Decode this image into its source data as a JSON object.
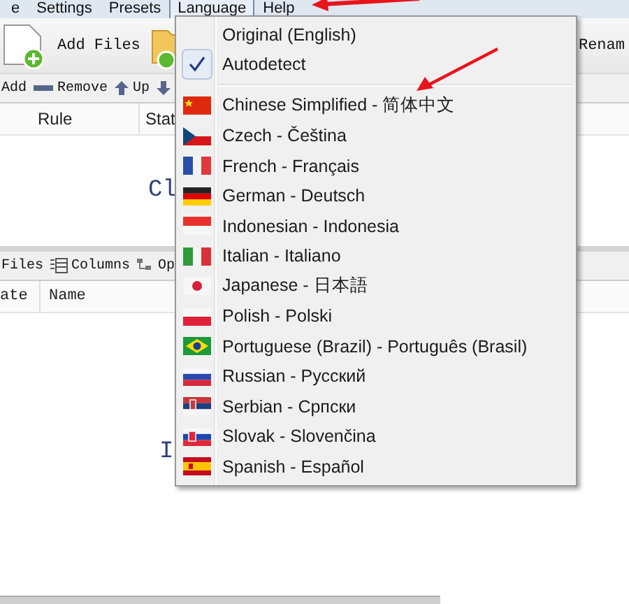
{
  "menu_bar": [
    {
      "label": "e",
      "selected": false
    },
    {
      "label": "Settings",
      "selected": false
    },
    {
      "label": "Presets",
      "selected": false
    },
    {
      "label": "Language",
      "selected": true
    },
    {
      "label": "Help",
      "selected": false
    }
  ],
  "toolbar": {
    "add_files": "Add Files",
    "rename": "Renam"
  },
  "rules_toolbar": [
    "Add",
    "Remove",
    "Up"
  ],
  "rules_columns": [
    "Rule",
    "Stat"
  ],
  "rules_hint": "Cl",
  "files_toolbar": [
    "Files",
    "Columns",
    "Op"
  ],
  "files_columns": [
    "ate",
    "Name"
  ],
  "files_hint": "I",
  "language_menu": [
    {
      "kind": "item",
      "label": "Original (English)",
      "checked": false
    },
    {
      "kind": "item",
      "label": "Autodetect",
      "checked": true
    },
    {
      "kind": "separator"
    },
    {
      "kind": "item",
      "label": "Chinese Simplified - 简体中文",
      "checked": false
    },
    {
      "kind": "item",
      "label": "Czech - Čeština",
      "checked": false
    },
    {
      "kind": "item",
      "label": "French - Français",
      "checked": false
    },
    {
      "kind": "item",
      "label": "German - Deutsch",
      "checked": false
    },
    {
      "kind": "item",
      "label": "Indonesian - Indonesia",
      "checked": false
    },
    {
      "kind": "item",
      "label": "Italian - Italiano",
      "checked": false
    },
    {
      "kind": "item",
      "label": "Japanese - 日本語",
      "checked": false
    },
    {
      "kind": "item",
      "label": "Polish - Polski",
      "checked": false
    },
    {
      "kind": "item",
      "label": "Portuguese (Brazil) - Português (Brasil)",
      "checked": false
    },
    {
      "kind": "item",
      "label": "Russian - Русский",
      "checked": false
    },
    {
      "kind": "item",
      "label": "Serbian - Српски",
      "checked": false
    },
    {
      "kind": "item",
      "label": "Slovak - Slovenčina",
      "checked": false
    },
    {
      "kind": "item",
      "label": "Spanish - Español",
      "checked": false
    }
  ]
}
